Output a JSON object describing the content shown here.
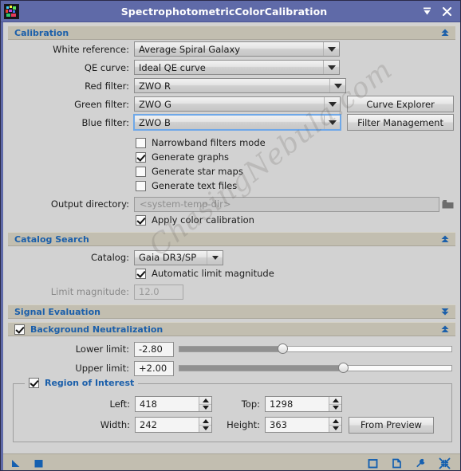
{
  "window": {
    "title": "SpectrophotometricColorCalibration",
    "app_icon": "pixinsight-process-icon",
    "titlebar_color": "#5f6aa8",
    "accent_color": "#1b5faa",
    "section_bar_color": "#c2beb0",
    "buttons": [
      {
        "name": "shade-button",
        "icon": "collapse-roll-up-icon"
      },
      {
        "name": "close-button",
        "icon": "close-icon"
      }
    ]
  },
  "watermark": {
    "text": "ChasingNebula.com"
  },
  "calibration": {
    "section_label": "Calibration",
    "collapse_icon": "double-chevron-up-icon",
    "white_reference": {
      "label": "White reference:",
      "value": "Average Spiral Galaxy"
    },
    "qe_curve": {
      "label": "QE curve:",
      "value": "Ideal QE curve"
    },
    "red_filter": {
      "label": "Red filter:",
      "value": "ZWO R"
    },
    "green_filter": {
      "label": "Green filter:",
      "value": "ZWO G"
    },
    "blue_filter": {
      "label": "Blue filter:",
      "value": "ZWO B",
      "focused": true
    },
    "curve_explorer_label": "Curve Explorer",
    "filter_management_label": "Filter Management",
    "checkboxes": [
      {
        "label": "Narrowband filters mode",
        "checked": false
      },
      {
        "label": "Generate graphs",
        "checked": true
      },
      {
        "label": "Generate star maps",
        "checked": false
      },
      {
        "label": "Generate text files",
        "checked": false
      }
    ],
    "output_directory": {
      "label": "Output directory:",
      "placeholder": "<system-temp-dir>",
      "browse_icon": "folder-icon"
    },
    "apply_color_calibration": {
      "label": "Apply color calibration",
      "checked": true
    }
  },
  "catalog_search": {
    "section_label": "Catalog Search",
    "collapse_icon": "double-chevron-up-icon",
    "catalog": {
      "label": "Catalog:",
      "value": "Gaia DR3/SP"
    },
    "automatic_limit_magnitude": {
      "label": "Automatic limit magnitude",
      "checked": true
    },
    "limit_magnitude": {
      "label": "Limit magnitude:",
      "value": "12.0",
      "disabled": true
    }
  },
  "signal_evaluation": {
    "section_label": "Signal Evaluation",
    "collapse_icon": "double-chevron-down-icon",
    "collapsed": true
  },
  "background_neutralization": {
    "section_label": "Background Neutralization",
    "checked": true,
    "collapse_icon": "double-chevron-up-icon",
    "lower_limit": {
      "label": "Lower limit:",
      "value": "-2.80",
      "slider_percent": 38
    },
    "upper_limit": {
      "label": "Upper limit:",
      "value": "+2.00",
      "slider_percent": 60
    }
  },
  "region_of_interest": {
    "title": "Region of Interest",
    "checked": true,
    "left": {
      "label": "Left:",
      "value": "418"
    },
    "top": {
      "label": "Top:",
      "value": "1298"
    },
    "width": {
      "label": "Width:",
      "value": "242"
    },
    "height": {
      "label": "Height:",
      "value": "363"
    },
    "from_preview_label": "From Preview"
  },
  "bottom_toolbar": {
    "left_icons": [
      {
        "name": "apply-arrow-icon"
      },
      {
        "name": "stop-square-icon"
      }
    ],
    "right_icons": [
      {
        "name": "new-instance-square-icon"
      },
      {
        "name": "document-icon"
      },
      {
        "name": "wrench-icon"
      },
      {
        "name": "collapse-arrows-icon"
      }
    ]
  }
}
